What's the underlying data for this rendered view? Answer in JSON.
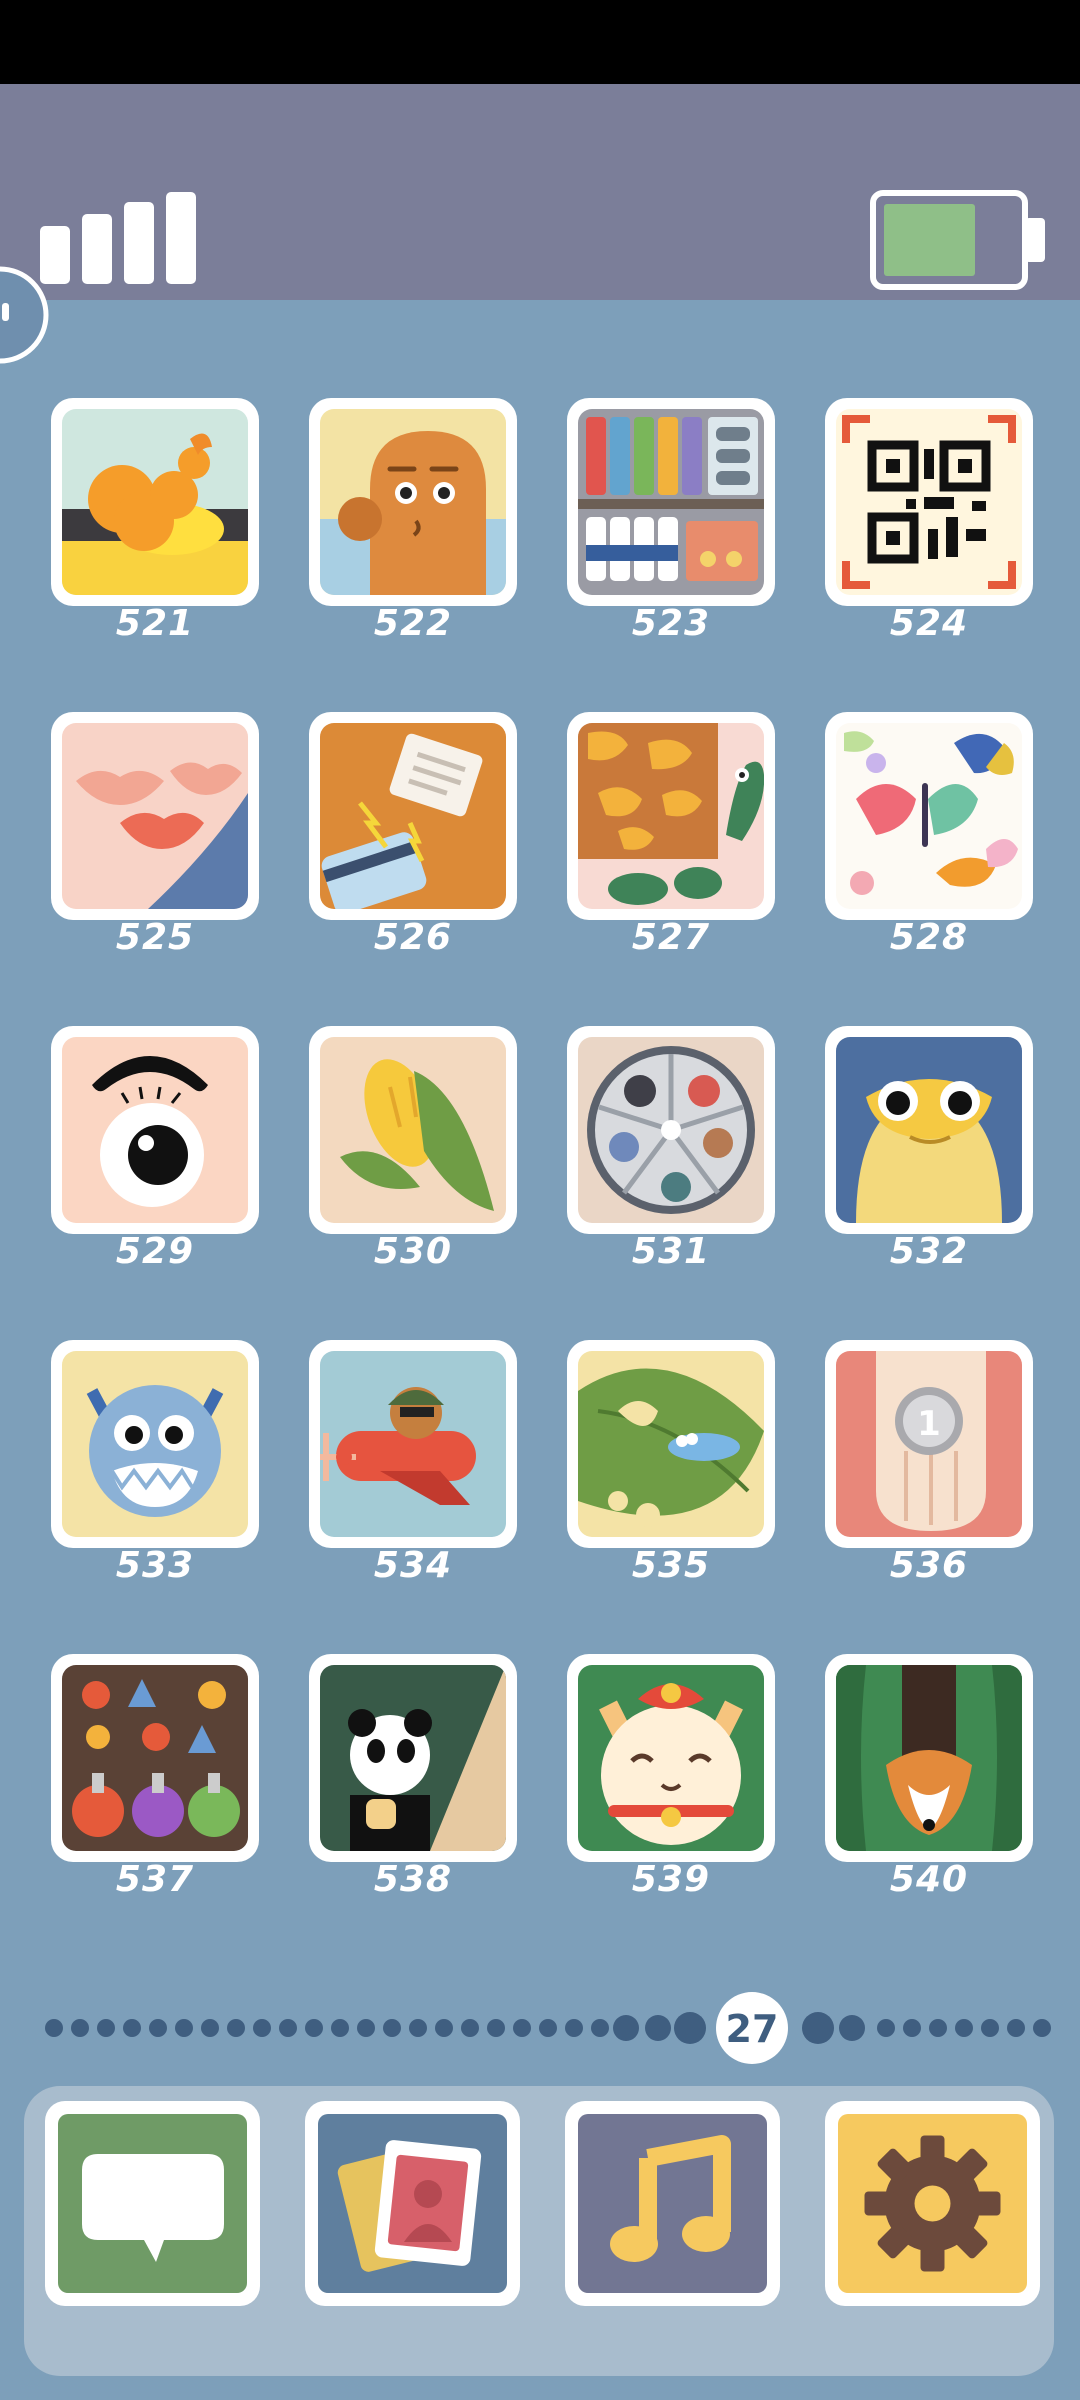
{
  "status": {
    "signal_icon": "signal-bars-icon",
    "battery_icon": "battery-icon",
    "battery_fill_fraction": 0.7,
    "battery_color": "#8fbf88"
  },
  "levels": [
    {
      "number": "521",
      "icon": "fried-shrimp-icon"
    },
    {
      "number": "522",
      "icon": "orange-creature-icon"
    },
    {
      "number": "523",
      "icon": "store-shelf-icon"
    },
    {
      "number": "524",
      "icon": "qr-code-icon"
    },
    {
      "number": "525",
      "icon": "lips-icon"
    },
    {
      "number": "526",
      "icon": "card-shock-icon"
    },
    {
      "number": "527",
      "icon": "turtle-icon"
    },
    {
      "number": "528",
      "icon": "butterflies-icon"
    },
    {
      "number": "529",
      "icon": "eye-icon"
    },
    {
      "number": "530",
      "icon": "corn-icon"
    },
    {
      "number": "531",
      "icon": "button-wheel-icon"
    },
    {
      "number": "532",
      "icon": "yellow-frog-icon"
    },
    {
      "number": "533",
      "icon": "blue-monster-icon"
    },
    {
      "number": "534",
      "icon": "plane-pilot-icon"
    },
    {
      "number": "535",
      "icon": "leaf-caterpillar-icon"
    },
    {
      "number": "536",
      "icon": "coin-in-hand-icon"
    },
    {
      "number": "537",
      "icon": "potion-bottles-icon"
    },
    {
      "number": "538",
      "icon": "panda-icon"
    },
    {
      "number": "539",
      "icon": "lucky-cat-icon"
    },
    {
      "number": "540",
      "icon": "corgi-icon"
    }
  ],
  "pager": {
    "current_page": "27",
    "dots_before": 25,
    "dots_after": 9
  },
  "dock": [
    {
      "icon": "messages-icon",
      "color": "#6f9b66"
    },
    {
      "icon": "photos-icon",
      "color": "#5f7f9e"
    },
    {
      "icon": "music-icon",
      "color": "#727693"
    },
    {
      "icon": "settings-gear-icon",
      "color": "#f6c95f"
    }
  ]
}
